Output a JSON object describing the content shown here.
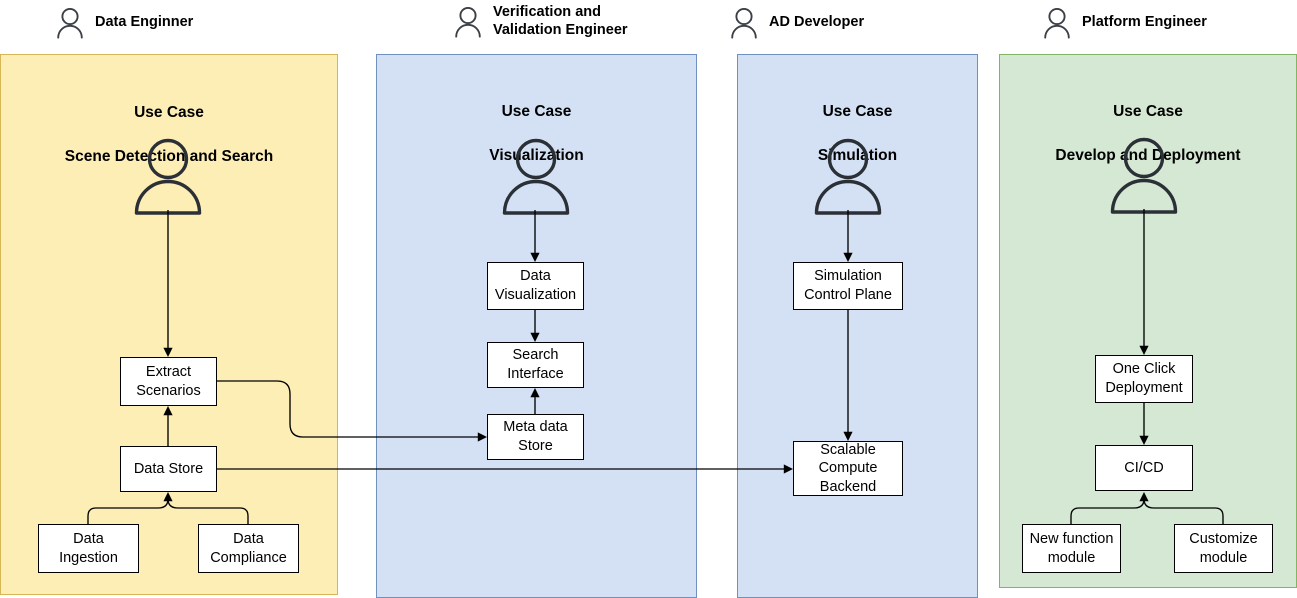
{
  "diagram": {
    "title": "Autonomous Driving Platform Use Case Swimlanes",
    "colors": {
      "lane_yellow_fill": "#fdeeb6",
      "lane_yellow_stroke": "#d6b656",
      "lane_blue_fill": "#d4e1f5",
      "lane_blue_stroke": "#7091c0",
      "lane_green_fill": "#d5e8d4",
      "lane_green_stroke": "#82b366",
      "node_fill": "#ffffff",
      "node_stroke": "#000000",
      "edge_stroke": "#000000",
      "text": "#000000"
    }
  },
  "actors": [
    {
      "icon": "person-icon",
      "label": "Data Enginner"
    },
    {
      "icon": "person-icon",
      "label": "Verification and\nValidation Engineer"
    },
    {
      "icon": "person-icon",
      "label": "AD Developer"
    },
    {
      "icon": "person-icon",
      "label": "Platform Engineer"
    }
  ],
  "lanes": [
    {
      "id": "lane-scene-detection",
      "use_case_label": "Use Case",
      "use_case_name": "Scene Detection and Search",
      "actor_icon": "person-icon",
      "nodes": [
        {
          "id": "extract-scenarios",
          "label": "Extract\nScenarios"
        },
        {
          "id": "data-store",
          "label": "Data Store"
        },
        {
          "id": "data-ingestion",
          "label": "Data\nIngestion"
        },
        {
          "id": "data-compliance",
          "label": "Data\nCompliance"
        }
      ]
    },
    {
      "id": "lane-visualization",
      "use_case_label": "Use Case",
      "use_case_name": "Visualization",
      "actor_icon": "person-icon",
      "nodes": [
        {
          "id": "data-visualization",
          "label": "Data\nVisualization"
        },
        {
          "id": "search-interface",
          "label": "Search\nInterface"
        },
        {
          "id": "meta-data-store",
          "label": "Meta data\nStore"
        }
      ]
    },
    {
      "id": "lane-simulation",
      "use_case_label": "Use Case",
      "use_case_name": "Simulation",
      "actor_icon": "person-icon",
      "nodes": [
        {
          "id": "simulation-control-plane",
          "label": "Simulation\nControl Plane"
        },
        {
          "id": "scalable-compute-backend",
          "label": "Scalable\nCompute\nBackend"
        }
      ]
    },
    {
      "id": "lane-develop-deployment",
      "use_case_label": "Use Case",
      "use_case_name": "Develop and Deployment",
      "actor_icon": "person-icon",
      "nodes": [
        {
          "id": "one-click-deployment",
          "label": "One Click\nDeployment"
        },
        {
          "id": "ci-cd",
          "label": "CI/CD"
        },
        {
          "id": "new-function-module",
          "label": "New function\nmodule"
        },
        {
          "id": "customize-module",
          "label": "Customize\nmodule"
        }
      ]
    }
  ],
  "connections": [
    {
      "from": "actor-data-engineer",
      "to": "extract-scenarios",
      "direction": "down"
    },
    {
      "from": "data-store",
      "to": "extract-scenarios",
      "direction": "up"
    },
    {
      "from": "data-ingestion",
      "to": "data-store",
      "direction": "up"
    },
    {
      "from": "data-compliance",
      "to": "data-store",
      "direction": "up"
    },
    {
      "from": "extract-scenarios",
      "to": "meta-data-store",
      "direction": "right"
    },
    {
      "from": "data-store",
      "to": "scalable-compute-backend",
      "direction": "right"
    },
    {
      "from": "actor-vv-engineer",
      "to": "data-visualization",
      "direction": "down"
    },
    {
      "from": "data-visualization",
      "to": "search-interface",
      "direction": "down"
    },
    {
      "from": "meta-data-store",
      "to": "search-interface",
      "direction": "up"
    },
    {
      "from": "actor-ad-developer",
      "to": "simulation-control-plane",
      "direction": "down"
    },
    {
      "from": "simulation-control-plane",
      "to": "scalable-compute-backend",
      "direction": "down"
    },
    {
      "from": "actor-platform-engineer",
      "to": "one-click-deployment",
      "direction": "down"
    },
    {
      "from": "one-click-deployment",
      "to": "ci-cd",
      "direction": "down"
    },
    {
      "from": "new-function-module",
      "to": "ci-cd",
      "direction": "up"
    },
    {
      "from": "customize-module",
      "to": "ci-cd",
      "direction": "up"
    }
  ]
}
